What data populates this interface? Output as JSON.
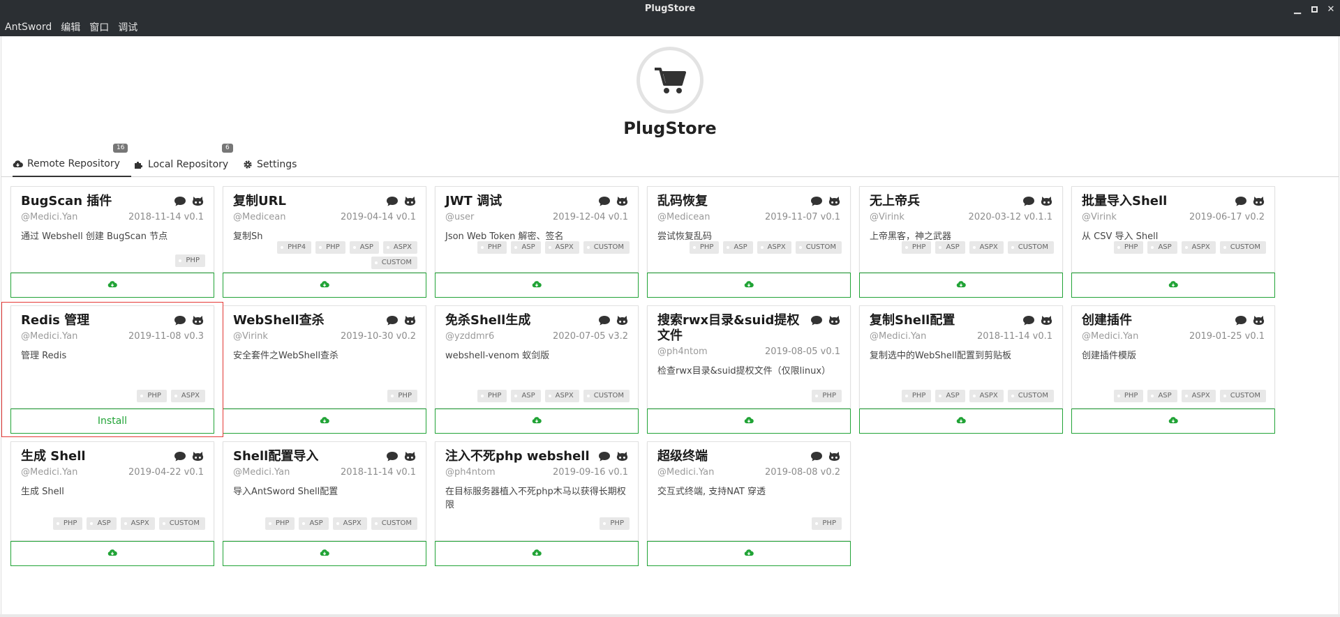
{
  "window": {
    "title": "PlugStore"
  },
  "menu": [
    "AntSword",
    "编辑",
    "窗口",
    "调试"
  ],
  "header": {
    "title": "PlugStore"
  },
  "tabs": [
    {
      "label": "Remote Repository",
      "badge": "16",
      "icon": "cloud-download-icon",
      "active": true
    },
    {
      "label": "Local Repository",
      "badge": "6",
      "icon": "puzzle-icon",
      "active": false
    },
    {
      "label": "Settings",
      "badge": "",
      "icon": "gear-icon",
      "active": false
    }
  ],
  "accent": "#21a336",
  "highlight_color": "#e53935",
  "plugins": [
    {
      "name": "BugScan 插件",
      "author": "@Medici.Yan",
      "date_version": "2018-11-14 v0.1",
      "desc": "通过 Webshell 创建 BugScan 节点",
      "tags": [
        "PHP"
      ],
      "install_label": ""
    },
    {
      "name": "复制URL",
      "author": "@Medicean",
      "date_version": "2019-04-14 v0.1",
      "desc": "复制Sh",
      "tags": [
        "PHP4",
        "PHP",
        "ASP",
        "ASPX",
        "CUSTOM"
      ],
      "install_label": ""
    },
    {
      "name": "JWT 调试",
      "author": "@user",
      "date_version": "2019-12-04 v0.1",
      "desc": "Json Web Token 解密、签名",
      "tags": [
        "PHP",
        "ASP",
        "ASPX",
        "CUSTOM"
      ],
      "install_label": ""
    },
    {
      "name": "乱码恢复",
      "author": "@Medicean",
      "date_version": "2019-11-07 v0.1",
      "desc": "尝试恢复乱码",
      "tags": [
        "PHP",
        "ASP",
        "ASPX",
        "CUSTOM"
      ],
      "install_label": ""
    },
    {
      "name": "无上帝兵",
      "author": "@Virink",
      "date_version": "2020-03-12 v0.1.1",
      "desc": "上帝黑客，神之武器",
      "tags": [
        "PHP",
        "ASP",
        "ASPX",
        "CUSTOM"
      ],
      "install_label": ""
    },
    {
      "name": "批量导入Shell",
      "author": "@Virink",
      "date_version": "2019-06-17 v0.2",
      "desc": "从 CSV 导入 Shell",
      "tags": [
        "PHP",
        "ASP",
        "ASPX",
        "CUSTOM"
      ],
      "install_label": ""
    },
    {
      "name": "Redis 管理",
      "author": "@Medici.Yan",
      "date_version": "2019-11-08 v0.3",
      "desc": "管理 Redis",
      "tags": [
        "PHP",
        "ASPX"
      ],
      "install_label": "Install"
    },
    {
      "name": "WebShell查杀",
      "author": "@Virink",
      "date_version": "2019-10-30 v0.2",
      "desc": "安全套件之WebShell查杀",
      "tags": [
        "PHP"
      ],
      "install_label": ""
    },
    {
      "name": "免杀Shell生成",
      "author": "@yzddmr6",
      "date_version": "2020-07-05 v3.2",
      "desc": "webshell-venom 蚁剑版",
      "tags": [
        "PHP",
        "ASP",
        "ASPX",
        "CUSTOM"
      ],
      "install_label": ""
    },
    {
      "name": "搜索rwx目录&suid提权文件",
      "author": "@ph4ntom",
      "date_version": "2019-08-05 v0.1",
      "desc": "检查rwx目录&suid提权文件（仅限linux）",
      "tags": [
        "PHP"
      ],
      "install_label": ""
    },
    {
      "name": "复制Shell配置",
      "author": "@Medici.Yan",
      "date_version": "2018-11-14 v0.1",
      "desc": "复制选中的WebShell配置到剪贴板",
      "tags": [
        "PHP",
        "ASP",
        "ASPX",
        "CUSTOM"
      ],
      "install_label": ""
    },
    {
      "name": "创建插件",
      "author": "@Medici.Yan",
      "date_version": "2019-01-25 v0.1",
      "desc": "创建插件模版",
      "tags": [
        "PHP",
        "ASP",
        "ASPX",
        "CUSTOM"
      ],
      "install_label": ""
    },
    {
      "name": "生成 Shell",
      "author": "@Medici.Yan",
      "date_version": "2019-04-22 v0.1",
      "desc": "生成 Shell",
      "tags": [
        "PHP",
        "ASP",
        "ASPX",
        "CUSTOM"
      ],
      "install_label": ""
    },
    {
      "name": "Shell配置导入",
      "author": "@Medici.Yan",
      "date_version": "2018-11-14 v0.1",
      "desc": "导入AntSword Shell配置",
      "tags": [
        "PHP",
        "ASP",
        "ASPX",
        "CUSTOM"
      ],
      "install_label": ""
    },
    {
      "name": "注入不死php webshell",
      "author": "@ph4ntom",
      "date_version": "2019-09-16 v0.1",
      "desc": "在目标服务器植入不死php木马以获得长期权限",
      "tags": [
        "PHP"
      ],
      "install_label": ""
    },
    {
      "name": "超级终端",
      "author": "@Medici.Yan",
      "date_version": "2019-08-08 v0.2",
      "desc": "交互式终端, 支持NAT 穿透",
      "tags": [
        "PHP"
      ],
      "install_label": ""
    }
  ]
}
